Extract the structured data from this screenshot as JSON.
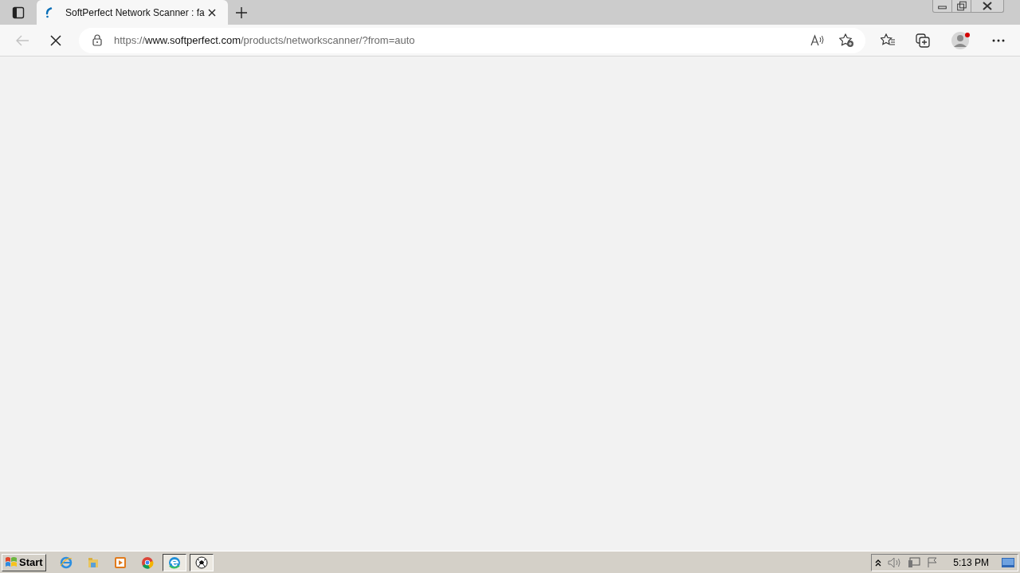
{
  "tabs": [
    {
      "title": "SoftPerfect Network Scanner : fa",
      "selected": true,
      "loading": true
    }
  ],
  "address_bar": {
    "scheme": "https://",
    "host": "www.softperfect.com",
    "path": "/products/networkscanner/?from=auto"
  },
  "taskbar": {
    "start_label": "Start",
    "apps": [
      {
        "selected": false
      },
      {
        "selected": false
      },
      {
        "selected": false
      },
      {
        "selected": false
      },
      {
        "selected": true
      },
      {
        "selected": true
      }
    ],
    "clock": "5:13 PM"
  }
}
